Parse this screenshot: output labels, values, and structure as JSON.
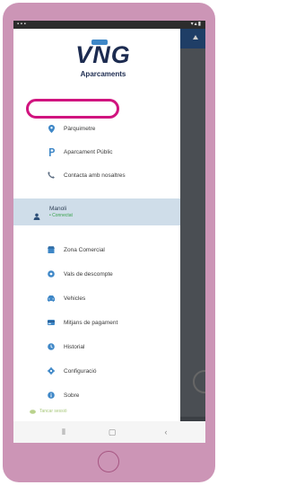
{
  "brand": {
    "logo_text": "VNG",
    "subtitle": "Aparcaments"
  },
  "menu_primary": [
    {
      "label": "Pàrquimetre",
      "icon": "location-pin-icon"
    },
    {
      "label": "Aparcament Públic",
      "icon": "parking-p-icon"
    },
    {
      "label": "Contacta amb nosaltres",
      "icon": "phone-icon"
    }
  ],
  "user": {
    "name": "Manoli",
    "status": "• Connectat"
  },
  "menu_secondary": [
    {
      "label": "Zona Comercial",
      "icon": "shop-icon"
    },
    {
      "label": "Vals de descompte",
      "icon": "coupon-icon"
    },
    {
      "label": "Vehicles",
      "icon": "car-icon"
    },
    {
      "label": "Mitjans de pagament",
      "icon": "credit-card-icon"
    },
    {
      "label": "Historial",
      "icon": "history-icon"
    },
    {
      "label": "Configuració",
      "icon": "gear-icon"
    },
    {
      "label": "Sobre",
      "icon": "info-icon"
    }
  ],
  "footer": {
    "text": "Tancar sessió"
  },
  "colors": {
    "accent": "#3e87c7",
    "highlight": "#d1147f",
    "phone_frame": "#cc95b6"
  }
}
